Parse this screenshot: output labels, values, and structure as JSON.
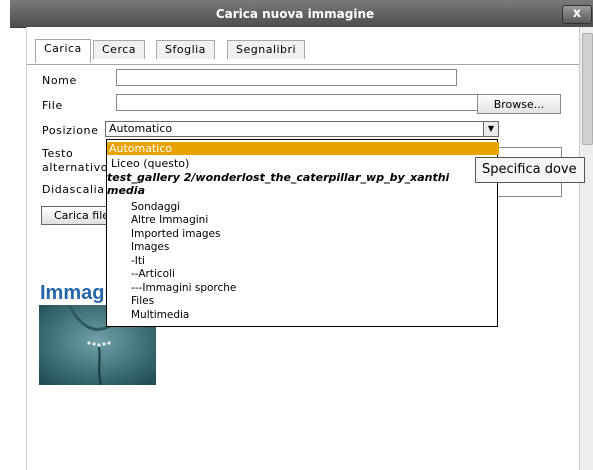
{
  "window": {
    "title": "Carica nuova immagine",
    "close_label": "x"
  },
  "tabs": [
    {
      "label": "Carica"
    },
    {
      "label": "Cerca"
    },
    {
      "label": "Sfoglia"
    },
    {
      "label": "Segnalibri"
    }
  ],
  "form": {
    "name_label": "Nome",
    "name_value": "",
    "file_label": "File",
    "file_value": "",
    "browse_label": "Browse...",
    "position_label": "Posizione",
    "position_selected": "Automatico",
    "alt_label_1": "Testo",
    "alt_label_2": "alternativo",
    "caption_label": "Didascalia",
    "upload_button": "Carica file"
  },
  "dropdown": {
    "options": [
      {
        "label": "Automatico",
        "kind": "selected"
      },
      {
        "label": "Liceo (questo)",
        "kind": "lev0"
      },
      {
        "label": "test_gallery 2/wonderlost_the_caterpillar_wp_by_xanthi",
        "kind": "grp"
      },
      {
        "label": "media",
        "kind": "grp"
      },
      {
        "label": "Sondaggi",
        "kind": "lev1"
      },
      {
        "label": "Altre Immagini",
        "kind": "lev1"
      },
      {
        "label": "Imported images",
        "kind": "lev1"
      },
      {
        "label": "Images",
        "kind": "lev1"
      },
      {
        "label": "-Iti",
        "kind": "lev1"
      },
      {
        "label": "--Articoli",
        "kind": "lev1"
      },
      {
        "label": "---Immagini sporche",
        "kind": "lev1"
      },
      {
        "label": "Files",
        "kind": "lev1"
      },
      {
        "label": "Multimedia",
        "kind": "lev1"
      }
    ]
  },
  "tooltip": {
    "text": "Specifica dove"
  },
  "images_section": {
    "heading": "Immagini"
  },
  "colors": {
    "accent": "#e8a300",
    "heading": "#2566a8",
    "titlebar": "#5a5a5a"
  },
  "icons": {
    "close": "close-icon",
    "select_arrow": "chevron-down-icon"
  }
}
